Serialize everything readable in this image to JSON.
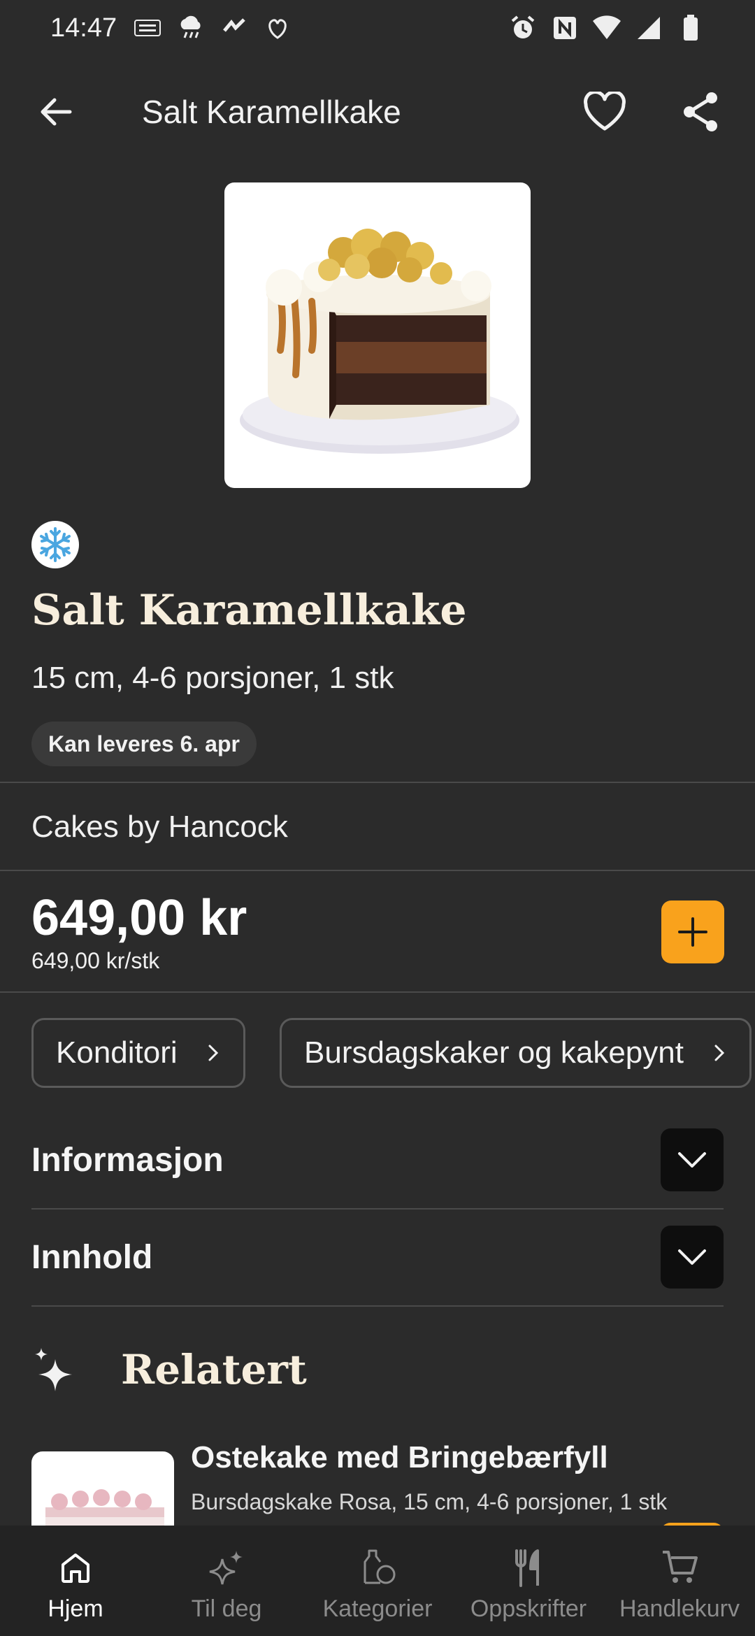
{
  "status_bar": {
    "time": "14:47",
    "left_icons": [
      "temu-icon",
      "weather-icon",
      "app-icon",
      "app2-icon"
    ],
    "right_icons": [
      "alarm-icon",
      "nfc-icon",
      "wifi-icon",
      "signal-icon",
      "battery-icon"
    ]
  },
  "top_bar": {
    "title": "Salt Karamellkake"
  },
  "product": {
    "title": "Salt Karamellkake",
    "subtitle": "15 cm, 4-6 porsjoner, 1 stk",
    "delivery": "Kan leveres 6. apr",
    "vendor": "Cakes by Hancock",
    "price": "649,00 kr",
    "unit_price": "649,00 kr/stk"
  },
  "categories": [
    {
      "label": "Konditori"
    },
    {
      "label": "Bursdagskaker og kakepynt"
    }
  ],
  "accordions": [
    {
      "label": "Informasjon"
    },
    {
      "label": "Innhold"
    }
  ],
  "related": {
    "title": "Relatert",
    "items": [
      {
        "name": "Ostekake med Bringebærfyll",
        "desc": "Bursdagskake Rosa, 15 cm, 4-6 porsjoner, 1 stk"
      }
    ]
  },
  "nav": {
    "items": [
      {
        "label": "Hjem",
        "icon": "home-icon",
        "active": true
      },
      {
        "label": "Til deg",
        "icon": "sparkle-icon"
      },
      {
        "label": "Kategorier",
        "icon": "categories-icon"
      },
      {
        "label": "Oppskrifter",
        "icon": "cutlery-icon"
      },
      {
        "label": "Handlekurv",
        "icon": "cart-icon"
      }
    ]
  },
  "colors": {
    "background": "#2b2b2b",
    "accent": "#f9a21c",
    "title_cream": "#f7eedd"
  }
}
